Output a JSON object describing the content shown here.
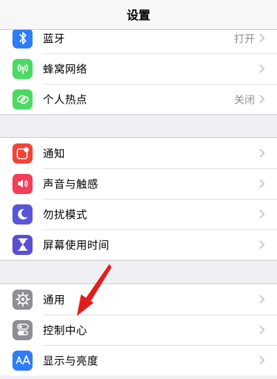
{
  "header": {
    "title": "设置"
  },
  "colors": {
    "bluetooth": "#2e7cf6",
    "cellular": "#4cd964",
    "hotspot": "#4cd964",
    "notifications": "#f44336",
    "sounds": "#f53d57",
    "dnd": "#5856d6",
    "screen_time": "#5a4fcf",
    "general": "#8e8e93",
    "control_center": "#8e8e93",
    "display": "#2e7cf6",
    "annotation_arrow": "#e51c1c"
  },
  "groups": [
    {
      "items": [
        {
          "label": "蓝牙",
          "value": "打开",
          "icon": "bluetooth-icon"
        },
        {
          "label": "蜂窝网络",
          "value": "",
          "icon": "cellular-antenna-icon"
        },
        {
          "label": "个人热点",
          "value": "关闭",
          "icon": "hotspot-link-icon"
        }
      ]
    },
    {
      "items": [
        {
          "label": "通知",
          "icon": "notifications-icon"
        },
        {
          "label": "声音与触感",
          "icon": "speaker-icon"
        },
        {
          "label": "勿扰模式",
          "icon": "moon-icon"
        },
        {
          "label": "屏幕使用时间",
          "icon": "hourglass-icon"
        }
      ]
    },
    {
      "items": [
        {
          "label": "通用",
          "icon": "gear-icon"
        },
        {
          "label": "控制中心",
          "icon": "toggles-icon"
        },
        {
          "label": "显示与亮度",
          "icon": "text-size-aa-icon"
        }
      ]
    }
  ]
}
